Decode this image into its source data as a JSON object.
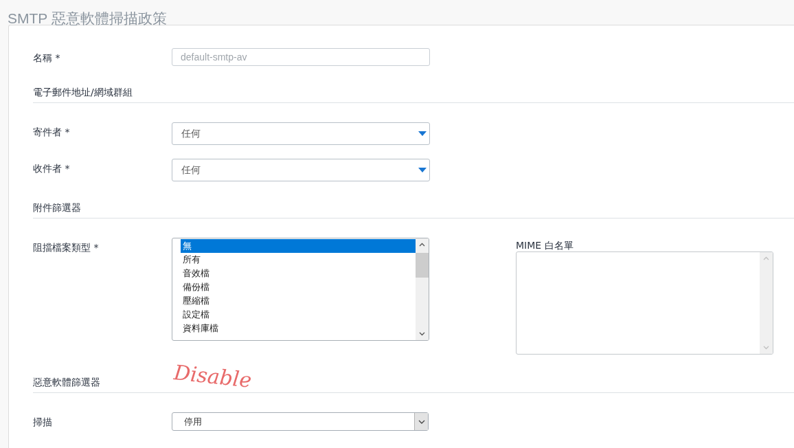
{
  "page_title": "SMTP 惡意軟體掃描政策",
  "sections": [
    {
      "rows": [
        {
          "label": "名稱 *",
          "control": {
            "kind": "text",
            "value": "default-smtp-av",
            "disabled": true
          }
        }
      ]
    },
    {
      "heading": "電子郵件地址/網域群組",
      "rows": [
        {
          "label": "寄件者 *",
          "control": {
            "kind": "dropdown",
            "value": "任何"
          }
        },
        {
          "label": "收件者 *",
          "control": {
            "kind": "dropdown",
            "value": "任何"
          }
        }
      ]
    },
    {
      "heading": "附件篩選器",
      "rows": [
        {
          "label": "阻擋檔案類型 *",
          "control": {
            "kind": "listbox",
            "items": [
              {
                "text": "無",
                "selected": true
              },
              {
                "text": "所有",
                "selected": false
              },
              {
                "text": "音效檔",
                "selected": false
              },
              {
                "text": "備份檔",
                "selected": false
              },
              {
                "text": "壓縮檔",
                "selected": false
              },
              {
                "text": "設定檔",
                "selected": false
              },
              {
                "text": "資料庫檔",
                "selected": false
              }
            ]
          },
          "side": {
            "label": "MIME 白名單",
            "kind": "textarea",
            "disabled": true
          }
        }
      ]
    },
    {
      "heading": "惡意軟體篩選器",
      "annotation": "Disable",
      "rows": [
        {
          "label": "掃描",
          "control": {
            "kind": "select",
            "value": "停用"
          }
        }
      ]
    }
  ]
}
